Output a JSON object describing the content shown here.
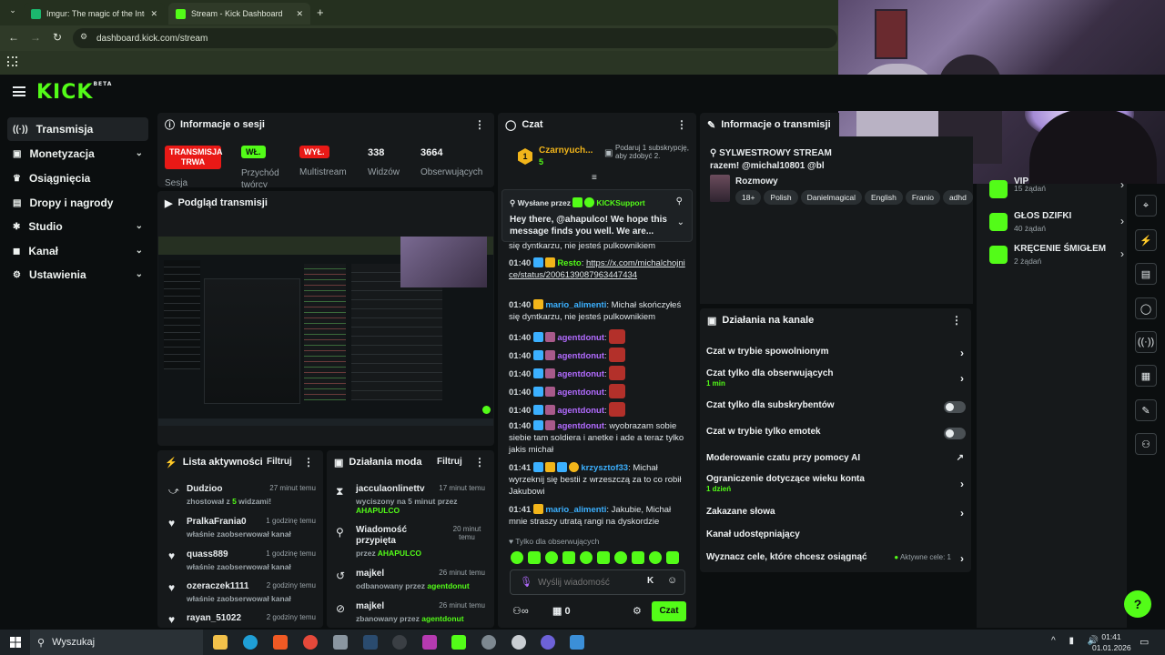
{
  "browser": {
    "tabs": [
      {
        "label": "Imgur: The magic of the Interne",
        "close": "✕"
      },
      {
        "label": "Stream - Kick Dashboard",
        "close": "✕"
      }
    ],
    "new_tab": "+",
    "url": "dashboard.kick.com/stream"
  },
  "brand": {
    "logo": "KICK",
    "beta": "BETA"
  },
  "sidebar": {
    "items": [
      {
        "label": "Transmisja",
        "icon": "broadcast-icon"
      },
      {
        "label": "Monetyzacja",
        "icon": "money-icon"
      },
      {
        "label": "Osiągnięcia",
        "icon": "trophy-icon"
      },
      {
        "label": "Dropy i nagrody",
        "icon": "gift-icon"
      },
      {
        "label": "Studio",
        "icon": "studio-icon"
      },
      {
        "label": "Kanał",
        "icon": "channel-icon"
      },
      {
        "label": "Ustawienia",
        "icon": "gear-icon"
      }
    ]
  },
  "session": {
    "title": "Informacje o sesji",
    "live_badge": "TRANSMISJA TRWA",
    "live_caption": "Sesja",
    "on_badge": "WŁ.",
    "on_caption": "Przychód twórcy",
    "off_badge": "WYŁ.",
    "off_caption": "Multistream",
    "viewers_value": "338",
    "viewers_label": "Widzów",
    "followers_value": "3664",
    "followers_label": "Obserwujących"
  },
  "preview": {
    "title": "Podgląd transmisji"
  },
  "activity": {
    "title": "Lista aktywności",
    "filter": "Filtruj",
    "items": [
      {
        "name": "Dudzioo",
        "time": "27 minut temu",
        "text": "zhostował z ",
        "count": "5",
        "text2": " widzami!"
      },
      {
        "name": "PralkaFrania0",
        "time": "1 godzinę temu",
        "text": "właśnie zaobserwował kanał"
      },
      {
        "name": "quass889",
        "time": "1 godzinę temu",
        "text": "właśnie zaobserwował kanał"
      },
      {
        "name": "ozeraczek1111",
        "time": "2 godziny temu",
        "text": "właśnie zaobserwował kanał"
      },
      {
        "name": "rayan_51022",
        "time": "2 godziny temu",
        "text": "właśnie zaobserwował kanał"
      }
    ]
  },
  "mod": {
    "title": "Działania moda",
    "filter": "Filtruj",
    "items": [
      {
        "name": "jacculaonlinettv",
        "time": "17 minut temu",
        "text": "wyciszony na 5 minut przez",
        "by": "AHAPULCO"
      },
      {
        "name": "Wiadomość przypięta",
        "time": "20 minut temu",
        "text": "przez",
        "by": "AHAPULCO"
      },
      {
        "name": "majkel",
        "time": "26 minut temu",
        "text": "odbanowany przez",
        "by": "agentdonut"
      },
      {
        "name": "majkel",
        "time": "26 minut temu",
        "text": "zbanowany przez",
        "by": "agentdonut"
      }
    ]
  },
  "chat": {
    "title": "Czat",
    "top_gifter": "Czarnyuch...",
    "top_gifter_count": "5",
    "gift_prompt": "Podaruj 1 subskrypcję, aby zdobyć 2.",
    "pinned_by": "Wysłane przez",
    "pinned_user": "KICKSupport",
    "pinned_text": "Hey there, @ahapulco! We hope this message finds you well. We are...",
    "lines": [
      {
        "ts": "",
        "user": "",
        "color": "#cfd5d8",
        "text": "się dyntkarzu, nie jesteś pulkownikiem"
      },
      {
        "ts": "01:40",
        "user": "Resto",
        "color": "#53fc18",
        "text": "https://x.com/michalchojnice/status/2006139087963447434"
      },
      {
        "ts": "01:40",
        "user": "mario_alimenti",
        "color": "#3bb0ff",
        "text": "Michał skończyłeś się dyntkarzu, nie jesteś pulkownikiem"
      },
      {
        "ts": "01:40",
        "user": "agentdonut",
        "color": "#b26bff",
        "text": ""
      },
      {
        "ts": "01:40",
        "user": "agentdonut",
        "color": "#b26bff",
        "text": ""
      },
      {
        "ts": "01:40",
        "user": "agentdonut",
        "color": "#b26bff",
        "text": ""
      },
      {
        "ts": "01:40",
        "user": "agentdonut",
        "color": "#b26bff",
        "text": ""
      },
      {
        "ts": "01:40",
        "user": "agentdonut",
        "color": "#b26bff",
        "text": ""
      },
      {
        "ts": "01:40",
        "user": "agentdonut",
        "color": "#b26bff",
        "text": "wyobrazam sobie siebie tam soldiera i anetke i ade  a teraz tylko jakis michał"
      },
      {
        "ts": "01:41",
        "user": "krzysztof33",
        "color": "#3bb0ff",
        "text": "Michał wyrzeknij się bestii z wrzeszczą za to co robił Jakubowi"
      },
      {
        "ts": "01:41",
        "user": "mario_alimenti",
        "color": "#3bb0ff",
        "text": "Jakubie, Michał mnie straszy utratą rangi na dyskordzie"
      }
    ],
    "followers_only": "Tylko dla obserwujących",
    "placeholder": "Wyślij wiadomość",
    "points": "0",
    "send": "Czat"
  },
  "stream_info": {
    "title": "Informacje o transmisji",
    "stream_title": "SYLWESTROWY STREAM razem! @michal10801 @bl",
    "category": "Rozmowy",
    "tags": [
      "18+",
      "Polish",
      "Danielmagical",
      "English",
      "Franio",
      "adhd"
    ]
  },
  "rewards": {
    "items": [
      {
        "name": "VIP",
        "count": "15 żądań"
      },
      {
        "name": "GŁOS DZIFKI",
        "count": "40 żądań"
      },
      {
        "name": "KRĘCENIE ŚMIGŁEM",
        "count": "2 żądań"
      }
    ]
  },
  "channel": {
    "title": "Działania na kanale",
    "rows": [
      {
        "label": "Czat w trybie spowolnionym",
        "sub": ""
      },
      {
        "label": "Czat tylko dla obserwujących",
        "sub": "1 min"
      },
      {
        "label": "Czat tylko dla subskrybentów",
        "sub": ""
      },
      {
        "label": "Czat w trybie tylko emotek",
        "sub": ""
      },
      {
        "label": "Moderowanie czatu przy pomocy AI",
        "sub": ""
      },
      {
        "label": "Ograniczenie dotyczące wieku konta",
        "sub": "1 dzień"
      },
      {
        "label": "Zakazane słowa",
        "sub": ""
      },
      {
        "label": "Kanał udostępniający",
        "sub": ""
      },
      {
        "label": "Wyznacz cele, które chcesz osiągnąć",
        "sub": ""
      }
    ],
    "goals_active": "Aktywne cele: 1"
  },
  "taskbar": {
    "search": "Wyszukaj",
    "time": "01:41",
    "date": "01.01.2026"
  },
  "colors": {
    "accent": "#53fc18",
    "live_red": "#e91916",
    "bg": "#0b0e0f",
    "panel": "#16191b"
  }
}
